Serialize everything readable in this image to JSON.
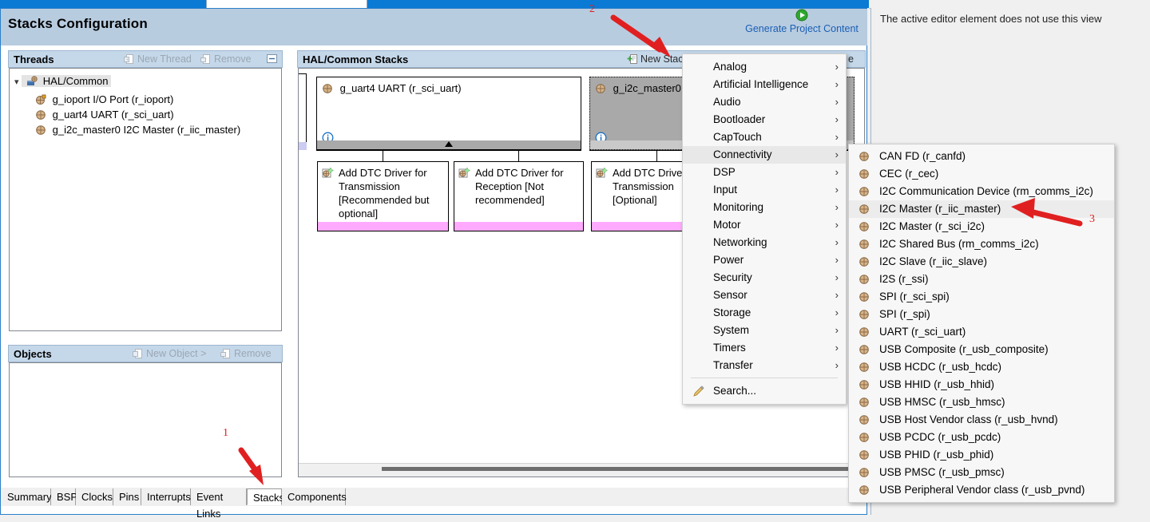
{
  "window": {
    "editor_title": "Stacks Configuration",
    "generate": {
      "label": "Generate Project Content",
      "icon": "play-circle-icon"
    }
  },
  "threads_panel": {
    "title": "Threads",
    "new_thread_label": "New Thread",
    "remove_label": "Remove",
    "collapse_label": "⊟",
    "tree": {
      "root": "HAL/Common",
      "children": [
        "g_ioport I/O Port (r_ioport)",
        "g_uart4 UART (r_sci_uart)",
        "g_i2c_master0 I2C Master (r_iic_master)"
      ]
    }
  },
  "objects_panel": {
    "title": "Objects",
    "new_object_label": "New Object >",
    "remove_label": "Remove",
    "items": []
  },
  "stacks_panel": {
    "title": "HAL/Common Stacks",
    "new_stack_label": "New Stack",
    "remove_label": "e",
    "stacks": [
      {
        "name": "g_uart4 UART (r_sci_uart)",
        "selected": false,
        "icon": "module-icon",
        "info_icon": "info-icon",
        "footer_color": "#a9a9a9",
        "children": [
          {
            "label": "Add DTC Driver for Transmission [Recommended but optional]",
            "icon": "add-module-icon",
            "footer_color": "#ffaaff"
          },
          {
            "label": "Add DTC Driver for Reception [Not recommended]",
            "icon": "add-module-icon",
            "footer_color": "#ffaaff"
          }
        ]
      },
      {
        "name": "g_i2c_master0 I2C Master (r_iic_master)",
        "selected": true,
        "icon": "module-icon",
        "info_icon": "info-icon",
        "footer_color": "#a9a9a9",
        "children": [
          {
            "label": "Add DTC Driver for Transmission [Optional]",
            "icon": "add-module-icon",
            "footer_color": "#ffaaff"
          }
        ]
      }
    ]
  },
  "bottom_tabs": {
    "items": [
      "Summary",
      "BSP",
      "Clocks",
      "Pins",
      "Interrupts",
      "Event Links",
      "Stacks",
      "Components"
    ],
    "active": "Stacks"
  },
  "right_view": {
    "message": "The active editor element does not use this view"
  },
  "context_menu": {
    "items": [
      {
        "label": "Analog",
        "has_submenu": true,
        "highlighted": false
      },
      {
        "label": "Artificial Intelligence",
        "has_submenu": true,
        "highlighted": false
      },
      {
        "label": "Audio",
        "has_submenu": true,
        "highlighted": false
      },
      {
        "label": "Bootloader",
        "has_submenu": true,
        "highlighted": false
      },
      {
        "label": "CapTouch",
        "has_submenu": true,
        "highlighted": false
      },
      {
        "label": "Connectivity",
        "has_submenu": true,
        "highlighted": true
      },
      {
        "label": "DSP",
        "has_submenu": true,
        "highlighted": false
      },
      {
        "label": "Input",
        "has_submenu": true,
        "highlighted": false
      },
      {
        "label": "Monitoring",
        "has_submenu": true,
        "highlighted": false
      },
      {
        "label": "Motor",
        "has_submenu": true,
        "highlighted": false
      },
      {
        "label": "Networking",
        "has_submenu": true,
        "highlighted": false
      },
      {
        "label": "Power",
        "has_submenu": true,
        "highlighted": false
      },
      {
        "label": "Security",
        "has_submenu": true,
        "highlighted": false
      },
      {
        "label": "Sensor",
        "has_submenu": true,
        "highlighted": false
      },
      {
        "label": "Storage",
        "has_submenu": true,
        "highlighted": false
      },
      {
        "label": "System",
        "has_submenu": true,
        "highlighted": false
      },
      {
        "label": "Timers",
        "has_submenu": true,
        "highlighted": false
      },
      {
        "label": "Transfer",
        "has_submenu": true,
        "highlighted": false
      }
    ],
    "search_label": "Search...",
    "search_icon": "search-pencil-icon",
    "arrow_glyph": "›"
  },
  "submenu": {
    "items": [
      {
        "label": "CAN FD (r_canfd)",
        "highlighted": false
      },
      {
        "label": "CEC (r_cec)",
        "highlighted": false
      },
      {
        "label": "I2C Communication Device (rm_comms_i2c)",
        "highlighted": false
      },
      {
        "label": "I2C Master (r_iic_master)",
        "highlighted": true
      },
      {
        "label": "I2C Master (r_sci_i2c)",
        "highlighted": false
      },
      {
        "label": "I2C Shared Bus (rm_comms_i2c)",
        "highlighted": false
      },
      {
        "label": "I2C Slave (r_iic_slave)",
        "highlighted": false
      },
      {
        "label": "I2S (r_ssi)",
        "highlighted": false
      },
      {
        "label": "SPI (r_sci_spi)",
        "highlighted": false
      },
      {
        "label": "SPI (r_spi)",
        "highlighted": false
      },
      {
        "label": "UART (r_sci_uart)",
        "highlighted": false
      },
      {
        "label": "USB Composite (r_usb_composite)",
        "highlighted": false
      },
      {
        "label": "USB HCDC (r_usb_hcdc)",
        "highlighted": false
      },
      {
        "label": "USB HHID (r_usb_hhid)",
        "highlighted": false
      },
      {
        "label": "USB HMSC (r_usb_hmsc)",
        "highlighted": false
      },
      {
        "label": "USB Host Vendor class (r_usb_hvnd)",
        "highlighted": false
      },
      {
        "label": "USB PCDC (r_usb_pcdc)",
        "highlighted": false
      },
      {
        "label": "USB PHID (r_usb_phid)",
        "highlighted": false
      },
      {
        "label": "USB PMSC (r_usb_pmsc)",
        "highlighted": false
      },
      {
        "label": "USB Peripheral Vendor class (r_usb_pvnd)",
        "highlighted": false
      }
    ]
  },
  "annotations": [
    {
      "number": "1"
    },
    {
      "number": "2"
    },
    {
      "number": "3"
    }
  ],
  "colors": {
    "accent_blue": "#0a7ad4",
    "panel_header": "#c5d8ea",
    "title_bar": "#b8cce0",
    "link": "#1a5fb4",
    "annotation_red": "#e02020",
    "selected_stack": "#a9a9a9",
    "pink_footer": "#ffaaff"
  }
}
